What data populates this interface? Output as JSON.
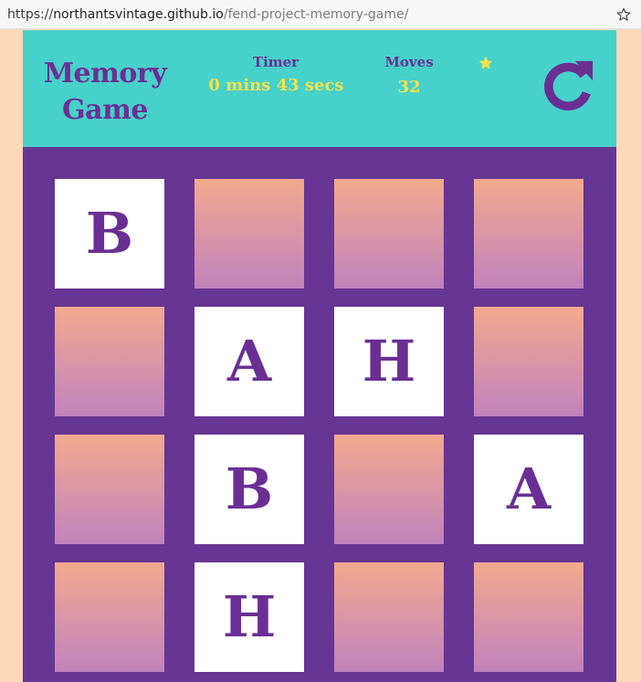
{
  "browser": {
    "url_scheme": "https://",
    "url_host": "northantsvintage.github.io",
    "url_path": "/fend-project-memory-game/"
  },
  "header": {
    "title_line1": "Memory",
    "title_line2": "Game",
    "timer_label": "Timer",
    "timer_value": "0 mins 43 secs",
    "moves_label": "Moves",
    "moves_value": "32",
    "stars": 1
  },
  "deck": {
    "cards": [
      {
        "state": "open",
        "letter": "B"
      },
      {
        "state": "closed",
        "letter": ""
      },
      {
        "state": "closed",
        "letter": ""
      },
      {
        "state": "closed",
        "letter": ""
      },
      {
        "state": "closed",
        "letter": ""
      },
      {
        "state": "open",
        "letter": "A"
      },
      {
        "state": "open",
        "letter": "H"
      },
      {
        "state": "closed",
        "letter": ""
      },
      {
        "state": "closed",
        "letter": ""
      },
      {
        "state": "open",
        "letter": "B"
      },
      {
        "state": "closed",
        "letter": ""
      },
      {
        "state": "open",
        "letter": "A"
      },
      {
        "state": "closed",
        "letter": ""
      },
      {
        "state": "open",
        "letter": "H"
      },
      {
        "state": "closed",
        "letter": ""
      },
      {
        "state": "closed",
        "letter": ""
      }
    ]
  },
  "colors": {
    "page_bg": "#fdd9b9",
    "header_bg": "#46d1ca",
    "deck_bg": "#673593",
    "title_color": "#6b2f94",
    "value_color": "#f3e14b",
    "card_gradient_top": "#f3a98e",
    "card_gradient_bottom": "#c082bc"
  }
}
